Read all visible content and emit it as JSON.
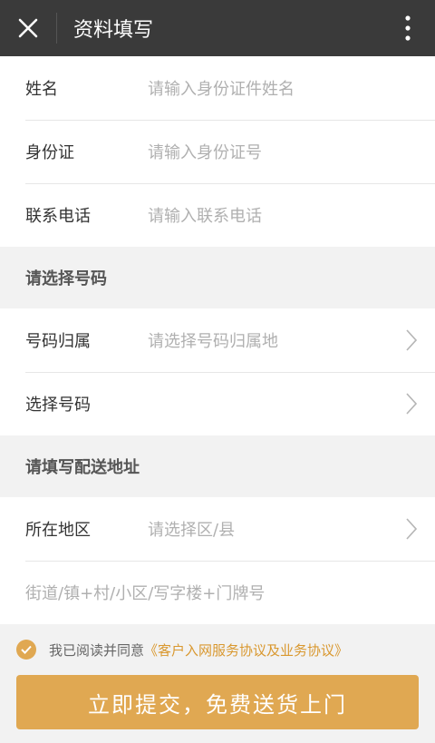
{
  "header": {
    "title": "资料填写",
    "close_icon": "close-icon",
    "menu_icon": "more-vertical-icon"
  },
  "personal": {
    "name_label": "姓名",
    "name_placeholder": "请输入身份证件姓名",
    "id_label": "身份证",
    "id_placeholder": "请输入身份证号",
    "phone_label": "联系电话",
    "phone_placeholder": "请输入联系电话"
  },
  "number_section": {
    "header": "请选择号码",
    "region_label": "号码归属",
    "region_placeholder": "请选择号码归属地",
    "select_label": "选择号码"
  },
  "address_section": {
    "header": "请填写配送地址",
    "area_label": "所在地区",
    "area_placeholder": "请选择区/县",
    "street_placeholder": "街道/镇+村/小区/写字楼+门牌号"
  },
  "agreement": {
    "text": "我已阅读并同意",
    "link": "《客户入网服务协议及业务协议》",
    "checked": true
  },
  "submit_label": "立即提交，免费送货上门",
  "colors": {
    "accent": "#e0a852",
    "topbar": "#3a3a3a",
    "link": "#d9982f"
  }
}
